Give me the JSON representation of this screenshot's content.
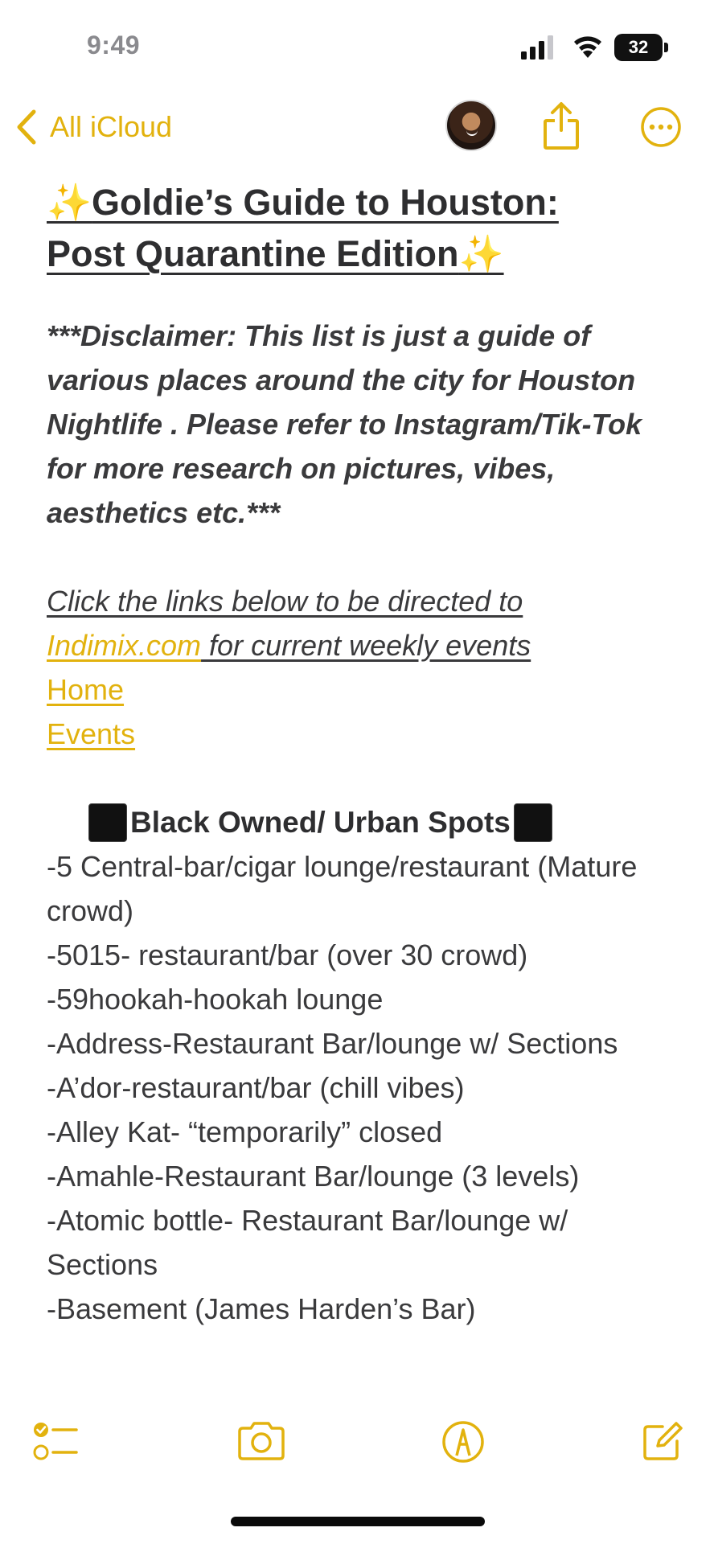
{
  "status_bar": {
    "time": "9:49",
    "battery_level": "32"
  },
  "nav": {
    "back_label": "All iCloud"
  },
  "note": {
    "title_part1": "Goldie’s Guide to Houston:",
    "title_part2": "Post Quarantine Edition",
    "disclaimer": "***Disclaimer: This list is just a guide of various places around the city for Houston Nightlife . Please refer to Instagram/Tik-Tok for more research on pictures, vibes, aesthetics etc.***",
    "links_intro_a": "Click the links below to be directed to",
    "links_intro_link": "Indimix.com",
    "links_intro_b": " for current weekly events",
    "link_home": "Home",
    "link_events": "Events",
    "section_heading": "Black Owned/ Urban Spots",
    "spots": [
      "-5 Central-bar/cigar lounge/restaurant (Mature crowd)",
      "-5015- restaurant/bar (over 30 crowd)",
      "-59hookah-hookah lounge",
      "-Address-Restaurant Bar/lounge w/ Sections",
      "-A’dor-restaurant/bar (chill vibes)",
      "-Alley Kat- “temporarily” closed",
      "-Amahle-Restaurant Bar/lounge (3 levels)",
      "-Atomic bottle- Restaurant Bar/lounge w/ Sections",
      "-Basement (James Harden’s Bar)"
    ]
  },
  "colors": {
    "accent": "#e2b20e",
    "text": "#2e2e30",
    "status_time": "#8a8a8e"
  },
  "icons": {
    "toolbar": [
      "checklist-icon",
      "camera-icon",
      "markup-icon",
      "compose-icon"
    ],
    "nav": [
      "chevron-left-icon",
      "share-icon",
      "more-icon"
    ]
  }
}
